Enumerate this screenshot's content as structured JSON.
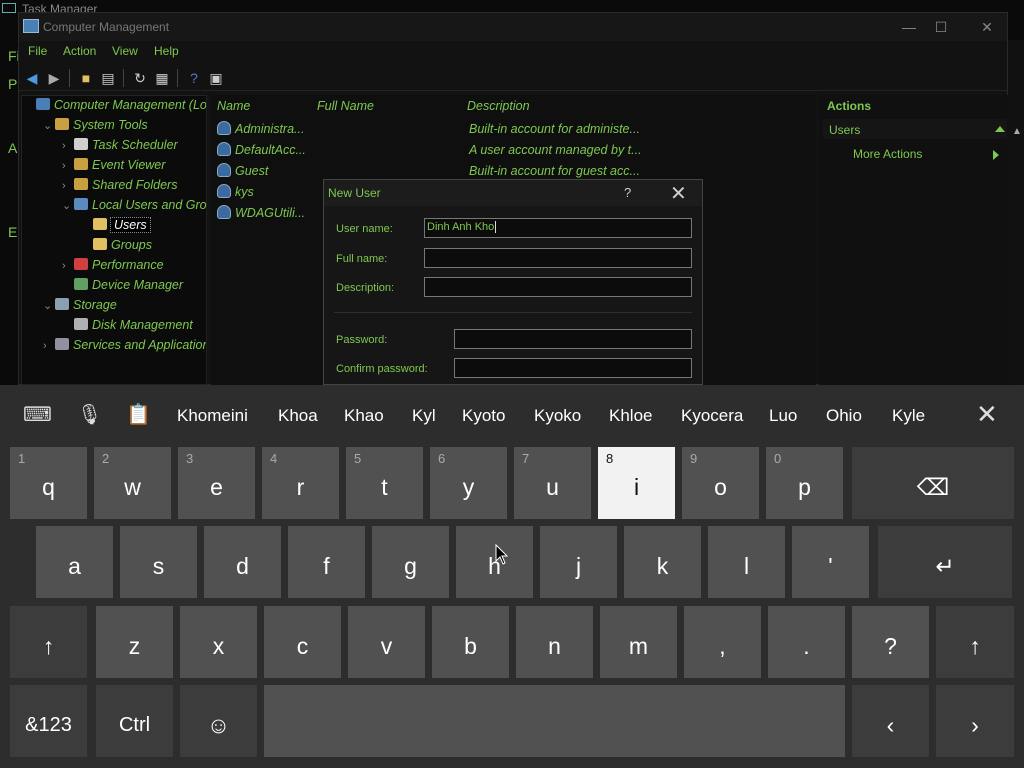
{
  "background": {
    "task_manager_title": "Task Manager",
    "left_letters": [
      "Fi",
      "P",
      "A",
      "E"
    ]
  },
  "window": {
    "title": "Computer Management",
    "menu": [
      "File",
      "Action",
      "View",
      "Help"
    ]
  },
  "tree": [
    {
      "label": "Computer Management (Lo",
      "level": 0,
      "chev": "",
      "icon_color": "#4a7fb5"
    },
    {
      "label": "System Tools",
      "level": 1,
      "chev": "v",
      "icon_color": "#c8a040"
    },
    {
      "label": "Task Scheduler",
      "level": 2,
      "chev": ">",
      "icon_color": "#d0d0d0"
    },
    {
      "label": "Event Viewer",
      "level": 2,
      "chev": ">",
      "icon_color": "#c8a040"
    },
    {
      "label": "Shared Folders",
      "level": 2,
      "chev": ">",
      "icon_color": "#c8a040"
    },
    {
      "label": "Local Users and Grou",
      "level": 2,
      "chev": "v",
      "icon_color": "#5a8ac0"
    },
    {
      "label": "Users",
      "level": 3,
      "chev": "",
      "icon_color": "#e0c060",
      "selected": true
    },
    {
      "label": "Groups",
      "level": 3,
      "chev": "",
      "icon_color": "#e0c060"
    },
    {
      "label": "Performance",
      "level": 2,
      "chev": ">",
      "icon_color": "#d04040"
    },
    {
      "label": "Device Manager",
      "level": 2,
      "chev": "",
      "icon_color": "#60a060"
    },
    {
      "label": "Storage",
      "level": 1,
      "chev": "v",
      "icon_color": "#8aa0b0"
    },
    {
      "label": "Disk Management",
      "level": 2,
      "chev": "",
      "icon_color": "#b0b0b0"
    },
    {
      "label": "Services and Applicatior",
      "level": 1,
      "chev": ">",
      "icon_color": "#9090a0"
    }
  ],
  "list": {
    "columns": {
      "name": "Name",
      "full_name": "Full Name",
      "description": "Description"
    },
    "rows": [
      {
        "name": "Administra...",
        "description": "Built-in account for administe..."
      },
      {
        "name": "DefaultAcc...",
        "description": "A user account managed by t..."
      },
      {
        "name": "Guest",
        "description": "Built-in account for guest acc..."
      },
      {
        "name": "kys",
        "description": ""
      },
      {
        "name": "WDAGUtili...",
        "description": ""
      }
    ]
  },
  "actions": {
    "header": "Actions",
    "section": "Users",
    "more": "More Actions"
  },
  "dialog": {
    "title": "New User",
    "help": "?",
    "close": "✕",
    "user_name_label": "User name:",
    "user_name_value": "Dinh Anh Kho",
    "full_name_label": "Full name:",
    "description_label": "Description:",
    "password_label": "Password:",
    "confirm_password_label": "Confirm password:"
  },
  "keyboard": {
    "suggestions": [
      "Khomeini",
      "Khoa",
      "Khao",
      "Kyl",
      "Kyoto",
      "Kyoko",
      "Khloe",
      "Kyocera",
      "Luo",
      "Ohio",
      "Kyle"
    ],
    "row1": [
      {
        "k": "q",
        "n": "1"
      },
      {
        "k": "w",
        "n": "2"
      },
      {
        "k": "e",
        "n": "3"
      },
      {
        "k": "r",
        "n": "4"
      },
      {
        "k": "t",
        "n": "5"
      },
      {
        "k": "y",
        "n": "6"
      },
      {
        "k": "u",
        "n": "7"
      },
      {
        "k": "i",
        "n": "8"
      },
      {
        "k": "o",
        "n": "9"
      },
      {
        "k": "p",
        "n": "0"
      }
    ],
    "row2": [
      "a",
      "s",
      "d",
      "f",
      "g",
      "h",
      "j",
      "k",
      "l",
      "'"
    ],
    "row3": [
      "z",
      "x",
      "c",
      "v",
      "b",
      "n",
      "m",
      ",",
      ".",
      "?"
    ],
    "symbols_key": "&123",
    "ctrl_key": "Ctrl",
    "active_key": "i"
  }
}
